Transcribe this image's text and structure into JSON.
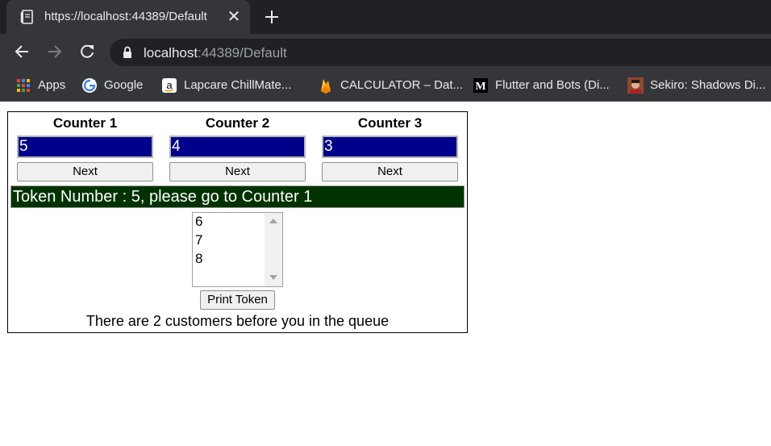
{
  "browser": {
    "tab_title": "https://localhost:44389/Default",
    "tab_close": "✕",
    "url_host": "localhost",
    "url_path": ":44389/Default",
    "bookmarks": [
      {
        "label": "Apps",
        "icon": "apps-grid-icon"
      },
      {
        "label": "Google",
        "icon": "google-icon"
      },
      {
        "label": "Lapcare ChillMate...",
        "icon": "amazon-icon"
      },
      {
        "label": "CALCULATOR – Dat...",
        "icon": "firebase-icon"
      },
      {
        "label": "Flutter and Bots (Di...",
        "icon": "medium-icon"
      },
      {
        "label": "Sekiro: Shadows Di...",
        "icon": "sekiro-avatar-icon"
      }
    ],
    "medium_letter": "M",
    "google_letter": "G",
    "amazon_letter": "a"
  },
  "counters": [
    {
      "title": "Counter 1",
      "value": "5",
      "button": "Next"
    },
    {
      "title": "Counter 2",
      "value": "4",
      "button": "Next"
    },
    {
      "title": "Counter 3",
      "value": "3",
      "button": "Next"
    }
  ],
  "token_message": "Token Number : 5, please go to Counter 1",
  "queue": [
    "6",
    "7",
    "8"
  ],
  "print_button": "Print Token",
  "queue_status": "There are 2 customers before you in the queue",
  "colors": {
    "counter_bg": "#00008b",
    "token_bar_bg": "#003300",
    "chrome_dark": "#202124",
    "chrome_toolbar": "#35363a"
  }
}
